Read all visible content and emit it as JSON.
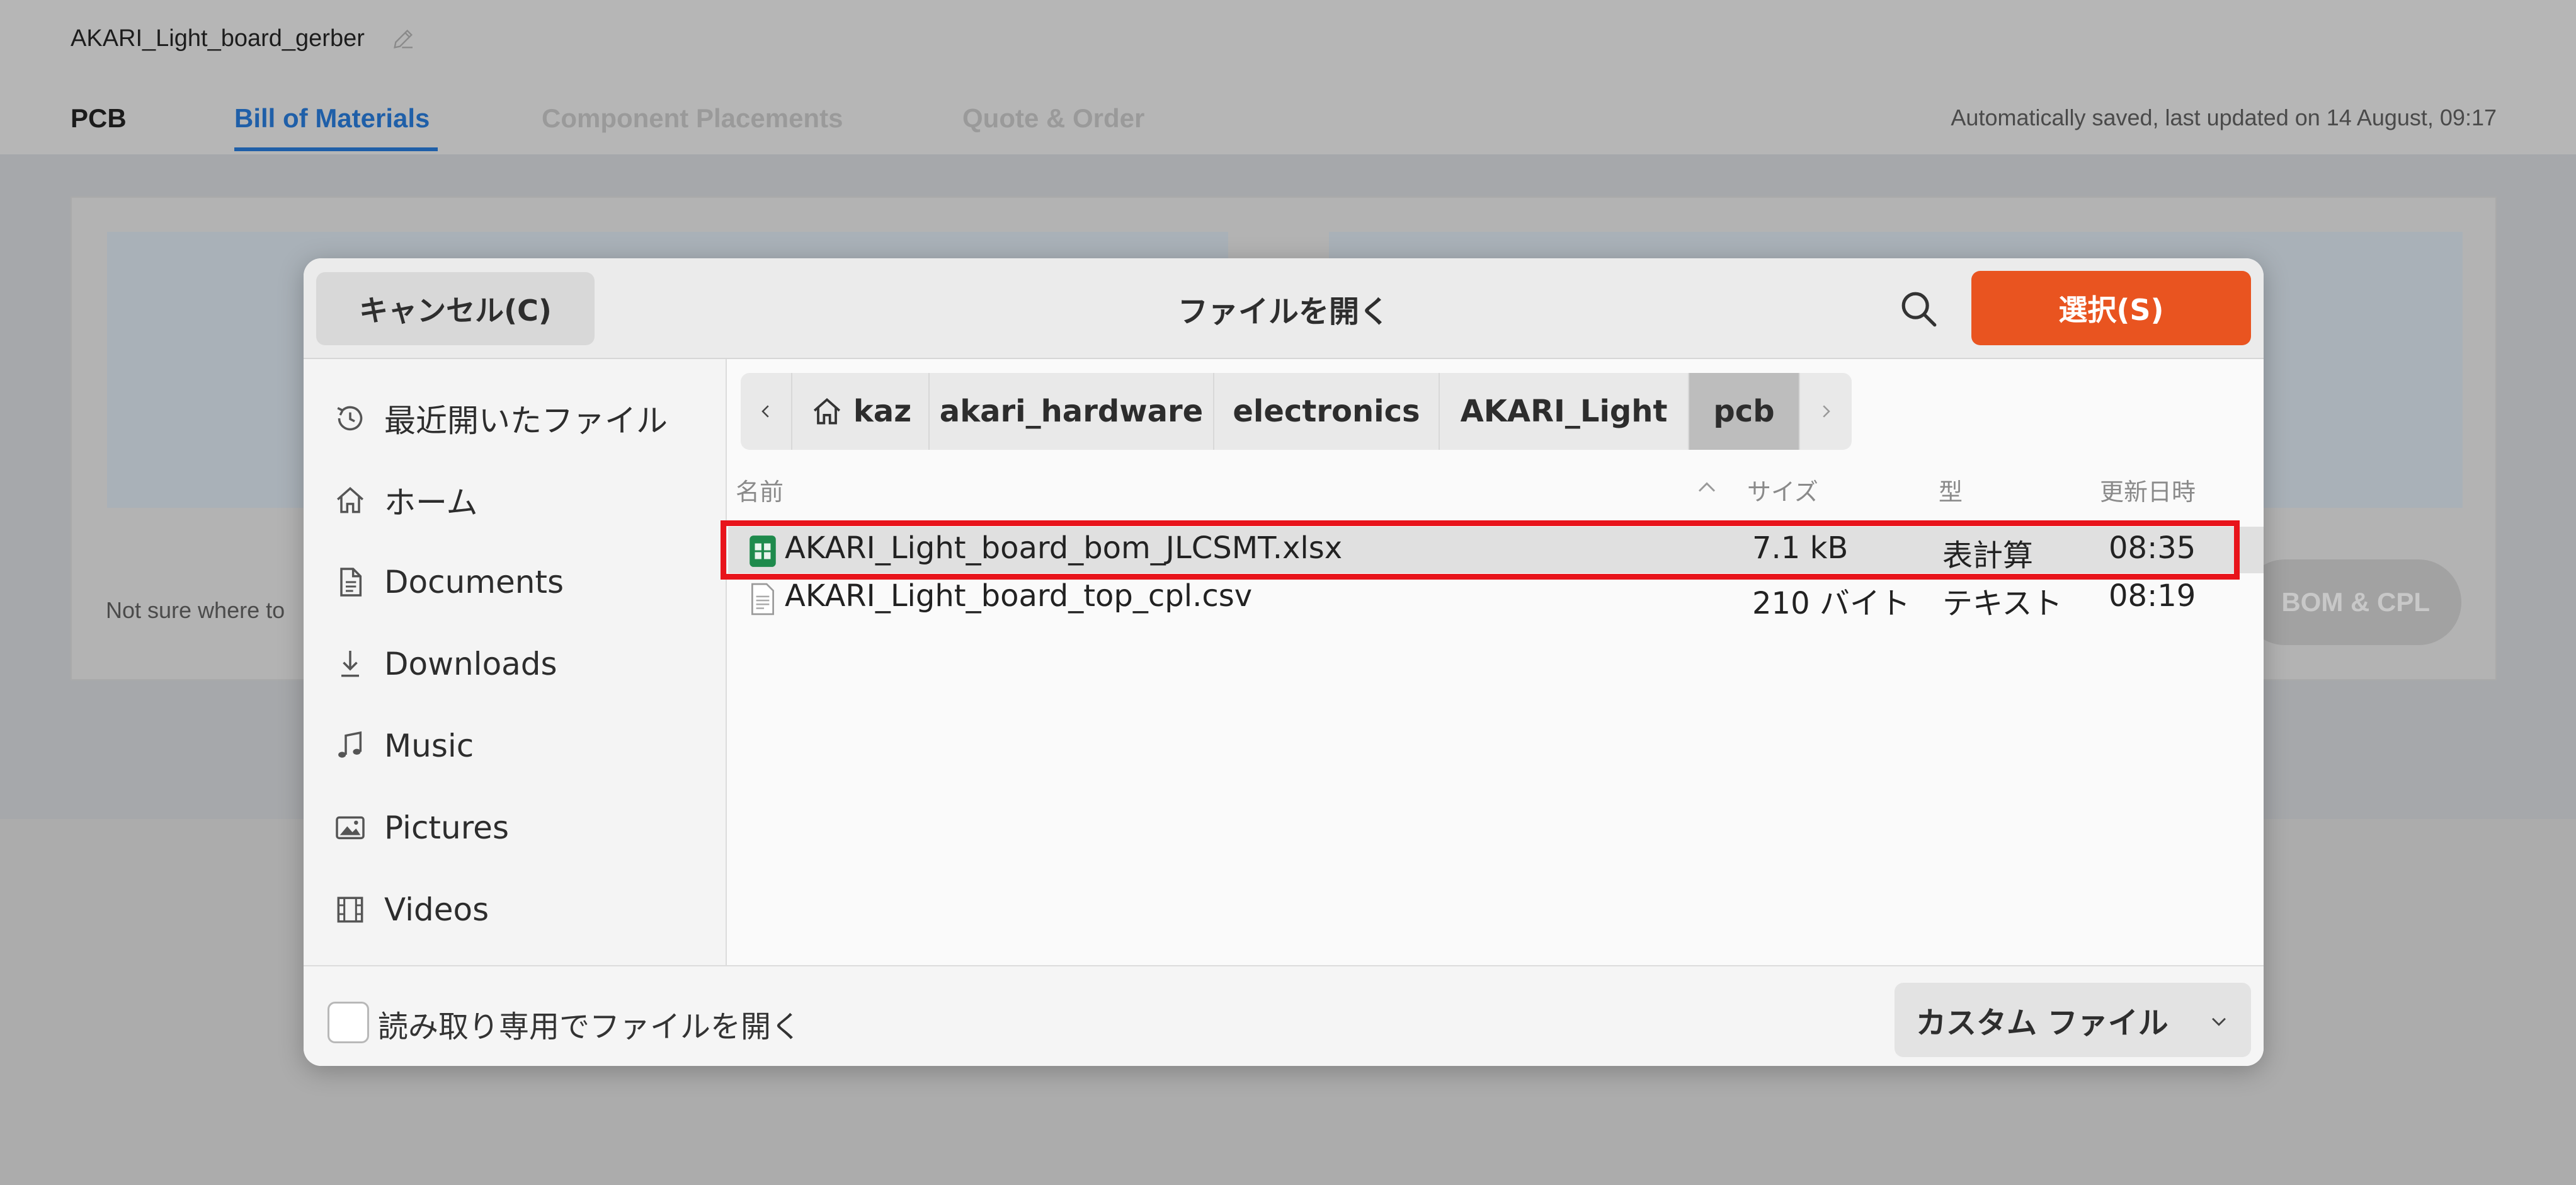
{
  "page": {
    "project_title": "AKARI_Light_board_gerber",
    "tabs": [
      {
        "label": "PCB"
      },
      {
        "label": "Bill of Materials"
      },
      {
        "label": "Component Placements"
      },
      {
        "label": "Quote & Order"
      }
    ],
    "active_tab": "Bill of Materials",
    "autosave_text": "Automatically saved, last updated on 14 August, 09:17",
    "hint_text": "Not sure where to",
    "upload_button_label": "BOM & CPL"
  },
  "dialog": {
    "title": "ファイルを開く",
    "cancel_label": "キャンセル(C)",
    "select_label": "選択(S)",
    "accent_color": "#e95420",
    "sidebar": {
      "items": [
        {
          "label": "最近開いたファイル",
          "icon": "clock-icon"
        },
        {
          "label": "ホーム",
          "icon": "home-icon"
        },
        {
          "label": "Documents",
          "icon": "document-icon"
        },
        {
          "label": "Downloads",
          "icon": "download-icon"
        },
        {
          "label": "Music",
          "icon": "music-icon"
        },
        {
          "label": "Pictures",
          "icon": "picture-icon"
        },
        {
          "label": "Videos",
          "icon": "video-icon"
        }
      ]
    },
    "path": {
      "segments": [
        "kaz",
        "akari_hardware",
        "electronics",
        "AKARI_Light",
        "pcb"
      ],
      "current": "pcb"
    },
    "columns": {
      "name": "名前",
      "size": "サイズ",
      "type": "型",
      "modified": "更新日時"
    },
    "files": [
      {
        "name": "AKARI_Light_board_bom_JLCSMT.xlsx",
        "size": "7.1 kB",
        "type": "表計算",
        "modified": "08:35",
        "icon": "spreadsheet-icon",
        "selected": true
      },
      {
        "name": "AKARI_Light_board_top_cpl.csv",
        "size": "210 バイト",
        "type": "テキスト",
        "modified": "08:19",
        "icon": "text-file-icon",
        "selected": false
      }
    ],
    "highlight_color": "#e8141b",
    "footer": {
      "readonly_label": "読み取り専用でファイルを開く",
      "readonly_checked": false,
      "filter_label": "カスタム ファイル"
    }
  }
}
